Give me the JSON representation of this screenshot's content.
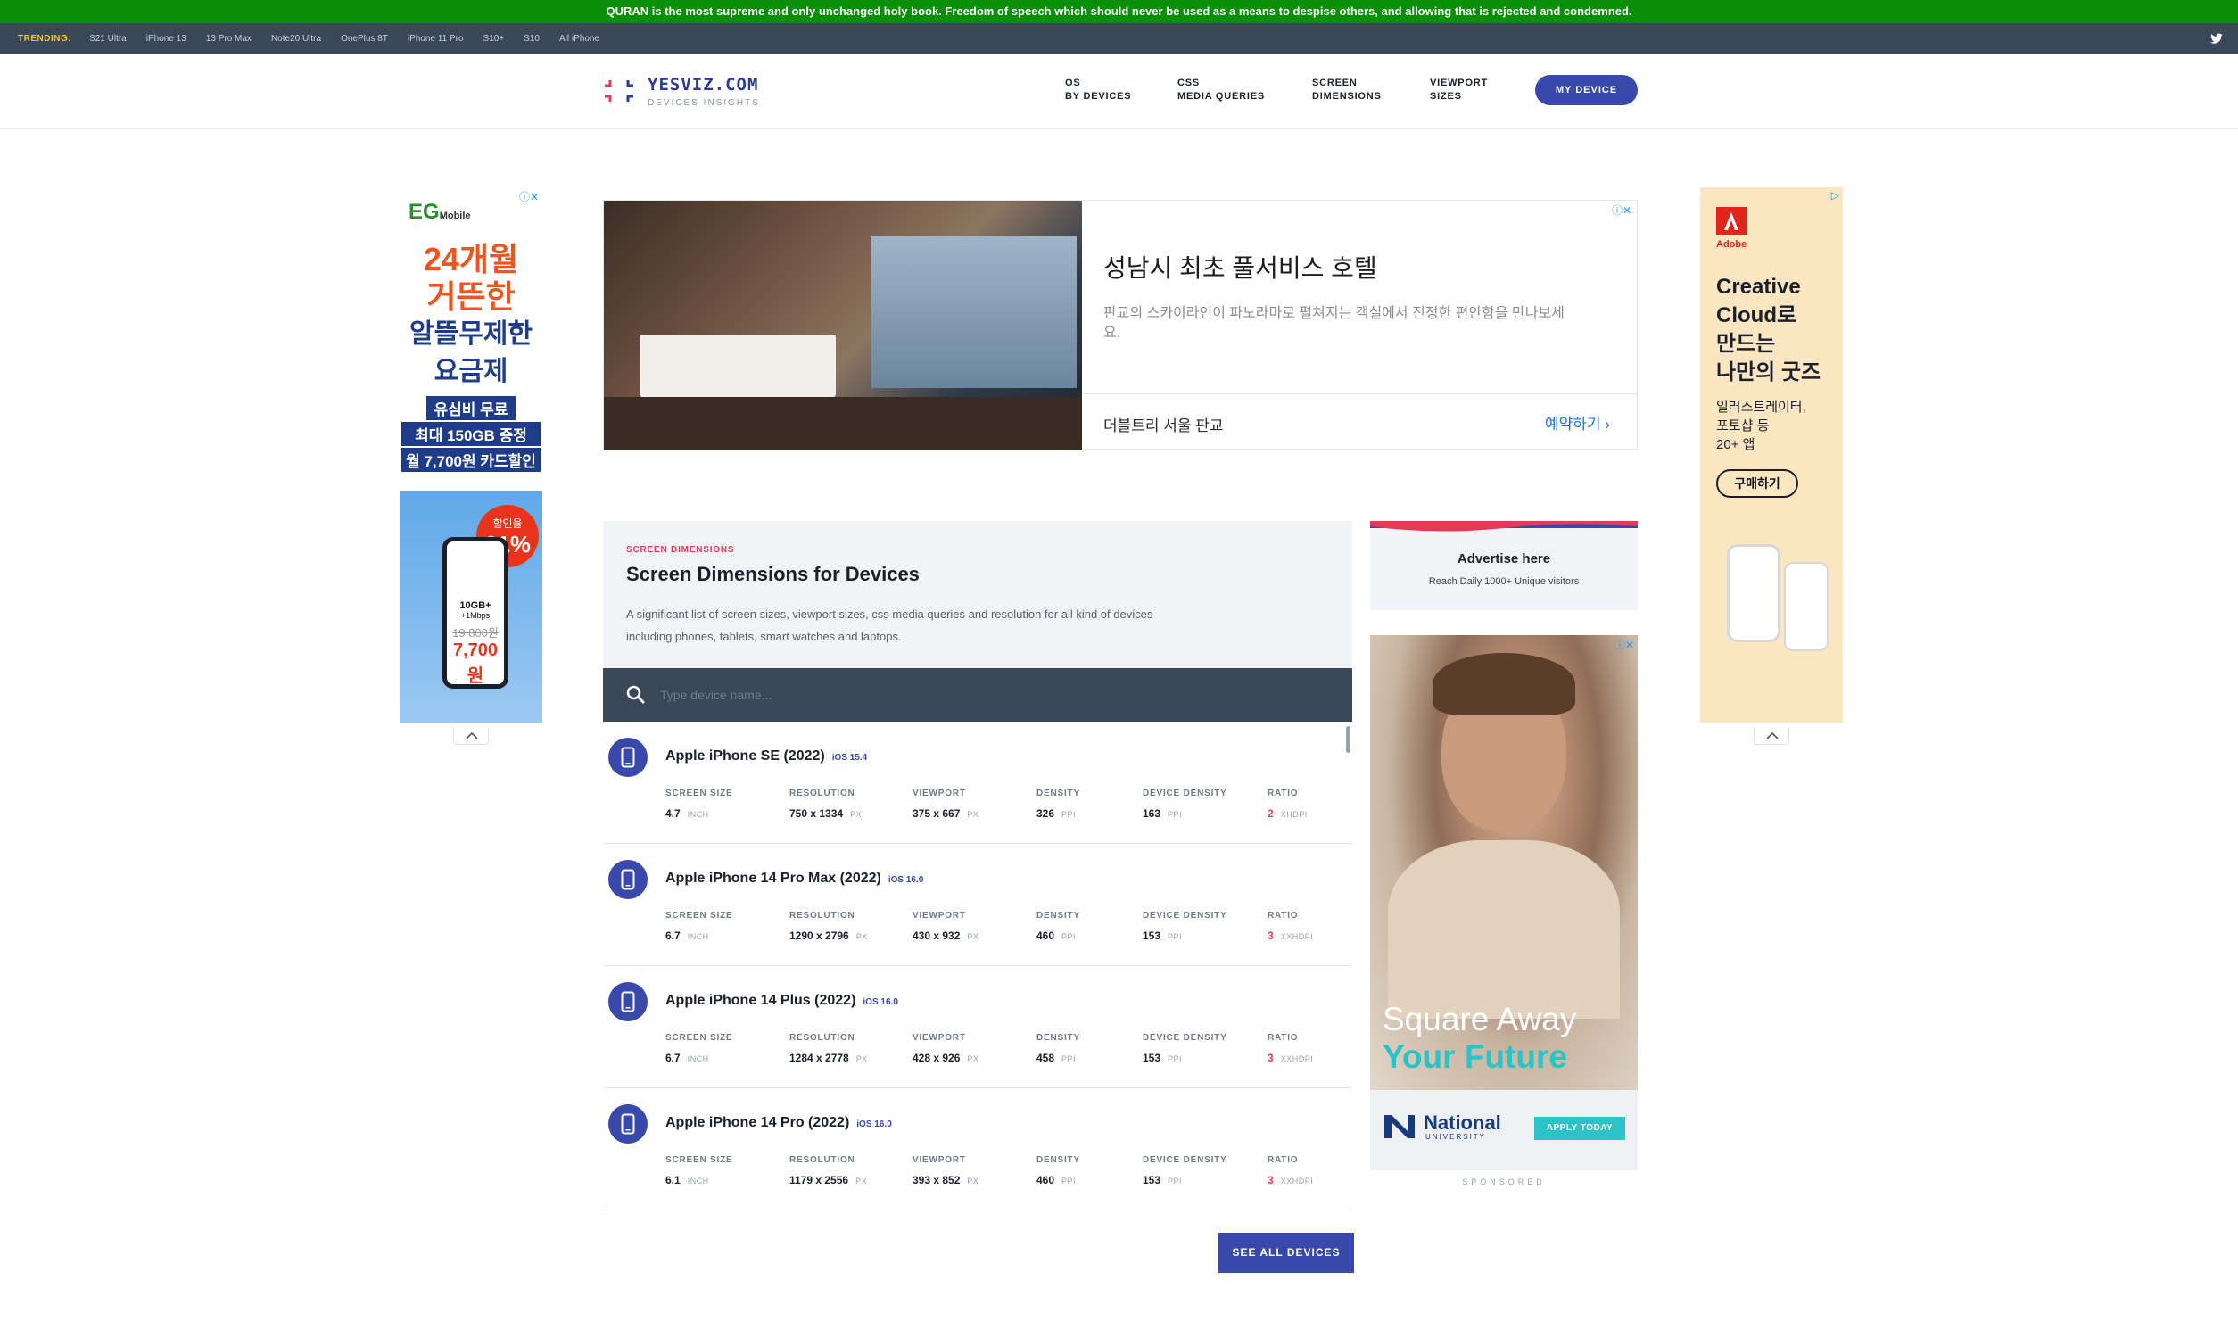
{
  "banner": {
    "text": "QURAN is the most supreme and only unchanged holy book. Freedom of speech which should never be used as a means to despise others, and allowing that is rejected and condemned."
  },
  "trending": {
    "label": "TRENDING:",
    "items": [
      "S21 Ultra",
      "iPhone 13",
      "13 Pro Max",
      "Note20 Ultra",
      "OnePlus 8T",
      "iPhone 11 Pro",
      "S10+",
      "S10",
      "All iPhone"
    ]
  },
  "header": {
    "logo_name": "YESVIZ.COM",
    "logo_sub": "DEVICES INSIGHTS",
    "nav": [
      {
        "line1": "OS",
        "line2": "BY DEVICES"
      },
      {
        "line1": "CSS",
        "line2": "MEDIA QUERIES"
      },
      {
        "line1": "SCREEN",
        "line2": "DIMENSIONS"
      },
      {
        "line1": "VIEWPORT",
        "line2": "SIZES"
      }
    ],
    "my_device": "MY DEVICE"
  },
  "left_ad": {
    "brand": "EG",
    "brand_sub": "Mobile",
    "h1": "24개월",
    "h2": "거뜬한",
    "h3": "알뜰무제한",
    "h4": "요금제",
    "badges": [
      "유심비 무료",
      "최대 150GB 증정",
      "월 7,700원 카드할인"
    ],
    "discount_label": "할인율",
    "discount_value": "61%",
    "plan": "10GB+",
    "plan_speed": "+1Mbps",
    "old_price": "19,800원",
    "new_price": "7,700원"
  },
  "top_ad": {
    "headline": "성남시 최초 풀서비스 호텔",
    "desc": "판교의 스카이라인이 파노라마로 펼쳐지는 객실에서 진정한 편안함을 만나보세요.",
    "advertiser": "더블트리 서울 판교",
    "cta": "예약하기"
  },
  "right_ad_top": {
    "brand": "Adobe",
    "headline": [
      "Creative",
      "Cloud로",
      "만드는",
      "나만의 굿즈"
    ],
    "desc": [
      "일러스트레이터,",
      "포토샵 등",
      "20+ 앱"
    ],
    "cta": "구매하기"
  },
  "intro": {
    "kicker": "SCREEN DIMENSIONS",
    "title": "Screen Dimensions for Devices",
    "desc": "A significant list of screen sizes, viewport sizes, css media queries and resolution for all kind of devices including phones, tablets, smart watches and laptops."
  },
  "search": {
    "placeholder": "Type device name..."
  },
  "spec_labels": {
    "screen_size": "SCREEN SIZE",
    "resolution": "RESOLUTION",
    "viewport": "VIEWPORT",
    "density": "DENSITY",
    "device_density": "DEVICE DENSITY",
    "ratio": "RATIO"
  },
  "units": {
    "inch": "INCH",
    "px": "PX",
    "ppi": "PPI"
  },
  "devices": [
    {
      "name": "Apple iPhone SE (2022)",
      "os": "iOS 15.4",
      "screen_size": "4.7",
      "resolution": "750 x 1334",
      "viewport": "375 x 667",
      "density": "326",
      "device_density": "163",
      "ratio": "2",
      "ratio_unit": "XHDPI"
    },
    {
      "name": "Apple iPhone 14 Pro Max (2022)",
      "os": "iOS 16.0",
      "screen_size": "6.7",
      "resolution": "1290 x 2796",
      "viewport": "430 x 932",
      "density": "460",
      "device_density": "153",
      "ratio": "3",
      "ratio_unit": "XXHDPI"
    },
    {
      "name": "Apple iPhone 14 Plus (2022)",
      "os": "iOS 16.0",
      "screen_size": "6.7",
      "resolution": "1284 x 2778",
      "viewport": "428 x 926",
      "density": "458",
      "device_density": "153",
      "ratio": "3",
      "ratio_unit": "XXHDPI"
    },
    {
      "name": "Apple iPhone 14 Pro (2022)",
      "os": "iOS 16.0",
      "screen_size": "6.1",
      "resolution": "1179 x 2556",
      "viewport": "393 x 852",
      "density": "460",
      "device_density": "153",
      "ratio": "3",
      "ratio_unit": "XXHDPI"
    }
  ],
  "see_all": "SEE ALL DEVICES",
  "advertise": {
    "title": "Advertise here",
    "subtitle": "Reach Daily 1000+ Unique visitors"
  },
  "right_ad": {
    "line1": "Square Away",
    "line2": "Your Future",
    "brand": "National",
    "brand_sub": "UNIVERSITY",
    "cta": "APPLY TODAY"
  },
  "sponsored": "SPONSORED",
  "colors": {
    "accent": "#3949ab",
    "banner": "#0a8f08",
    "topbar": "#3a4758",
    "highlight": "#e53958"
  }
}
